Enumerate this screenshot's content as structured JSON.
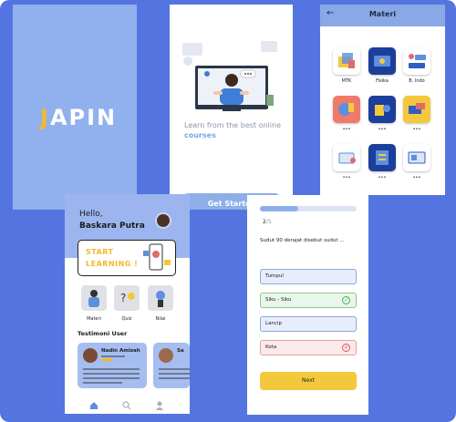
{
  "splash": {
    "logo_first": "J",
    "logo_rest": "APIN"
  },
  "onboarding": {
    "caption_line": "Learn from the best online",
    "caption_highlight": "courses",
    "start_button": "Get Started"
  },
  "materi": {
    "title": "Materi",
    "subjects": [
      "MTK",
      "Fisika",
      "B. Indo",
      "•••",
      "•••",
      "•••",
      "•••",
      "•••",
      "•••"
    ]
  },
  "home": {
    "greeting": "Hello,",
    "user_name": "Baskara Putra",
    "banner_line1": "START",
    "banner_line2": "LEARNING !",
    "menu": [
      "Materi",
      "Quiz",
      "Nilai"
    ],
    "testimoni_title": "Testimoni User",
    "testimonials": [
      {
        "name": "Nadin Amizah"
      },
      {
        "name": "Sa"
      }
    ]
  },
  "quiz": {
    "progress_current": "2",
    "progress_total": "/5",
    "progress_fraction": 0.4,
    "question": "Sudut 90 derajat disebut sudut ...",
    "options": [
      {
        "text": "Tumpul",
        "state": "default"
      },
      {
        "text": "Siku - Siku",
        "state": "correct"
      },
      {
        "text": "Lancip",
        "state": "default"
      },
      {
        "text": "Kota",
        "state": "wrong"
      }
    ],
    "next_button": "Next"
  },
  "colors": {
    "background": "#5475e0",
    "accent_yellow": "#f2b92a",
    "light_blue": "#91b0ee",
    "correct": "#4caf50",
    "wrong": "#e05a5a"
  }
}
